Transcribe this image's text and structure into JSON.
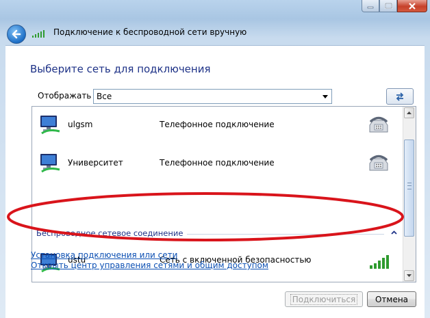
{
  "window": {
    "title": "Подключение к беспроводной сети вручную"
  },
  "header": {
    "heading": "Выберите сеть для подключения"
  },
  "filter": {
    "label": "Отображать",
    "selected": "Все"
  },
  "networks": [
    {
      "name": "ulgsm",
      "type": "Телефонное подключение",
      "kind": "dialup"
    },
    {
      "name": "Университет",
      "type": "Телефонное подключение",
      "kind": "dialup"
    },
    {
      "name": "ustu",
      "type": "Сеть с включенной безопасностью",
      "kind": "wireless",
      "signal_bars": 5
    }
  ],
  "group": {
    "label": "Беспроводное сетевое соединение"
  },
  "links": {
    "setup": "Установка подключения или сети",
    "network_center": "Открыть центр управления сетями и общим доступом"
  },
  "buttons": {
    "connect": "Подключиться",
    "cancel": "Отмена"
  },
  "colors": {
    "heading": "#1e3287",
    "link": "#0b4fb3",
    "highlight_ellipse": "#d9141b",
    "signal_green": "#2f9b2f"
  }
}
